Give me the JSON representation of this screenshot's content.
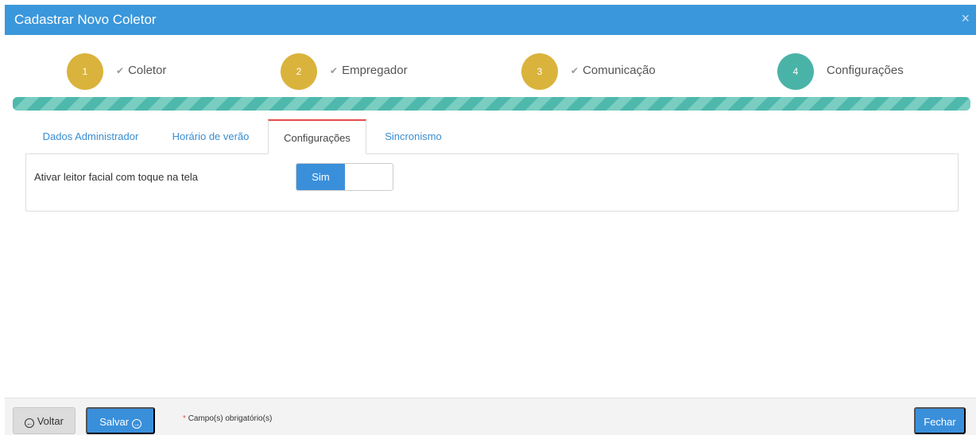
{
  "modal": {
    "title": "Cadastrar Novo Coletor",
    "close_glyph": "×"
  },
  "steps": [
    {
      "number": "1",
      "label": "Coletor",
      "done": true,
      "color": "#dab33c"
    },
    {
      "number": "2",
      "label": "Empregador",
      "done": true,
      "color": "#dab33c"
    },
    {
      "number": "3",
      "label": "Comunicação",
      "done": true,
      "color": "#dab33c"
    },
    {
      "number": "4",
      "label": "Configurações",
      "done": false,
      "color": "#4ab3a7"
    }
  ],
  "check_glyph": "✔",
  "progress": {
    "value": 1.0,
    "color": "#4fb8ac"
  },
  "tabs": [
    {
      "label": "Dados Administrador",
      "active": false
    },
    {
      "label": "Horário de verão",
      "active": false
    },
    {
      "label": "Configurações",
      "active": true
    },
    {
      "label": "Sincronismo",
      "active": false
    }
  ],
  "settings": {
    "facial_touch_label": "Ativar leitor facial com toque na tela",
    "facial_touch_value": "Sim"
  },
  "footer": {
    "back_label": "Voltar",
    "save_label": "Salvar",
    "required_star": "*",
    "required_text": "Campo(s) obrigatório(s)",
    "close_label": "Fechar"
  },
  "icons": {
    "back": "arrow-left-circle-icon",
    "save": "arrow-right-circle-icon"
  },
  "colors": {
    "header": "#3a97db",
    "primary_button": "#3a8fdb",
    "active_tab_border": "#e84a4a"
  }
}
